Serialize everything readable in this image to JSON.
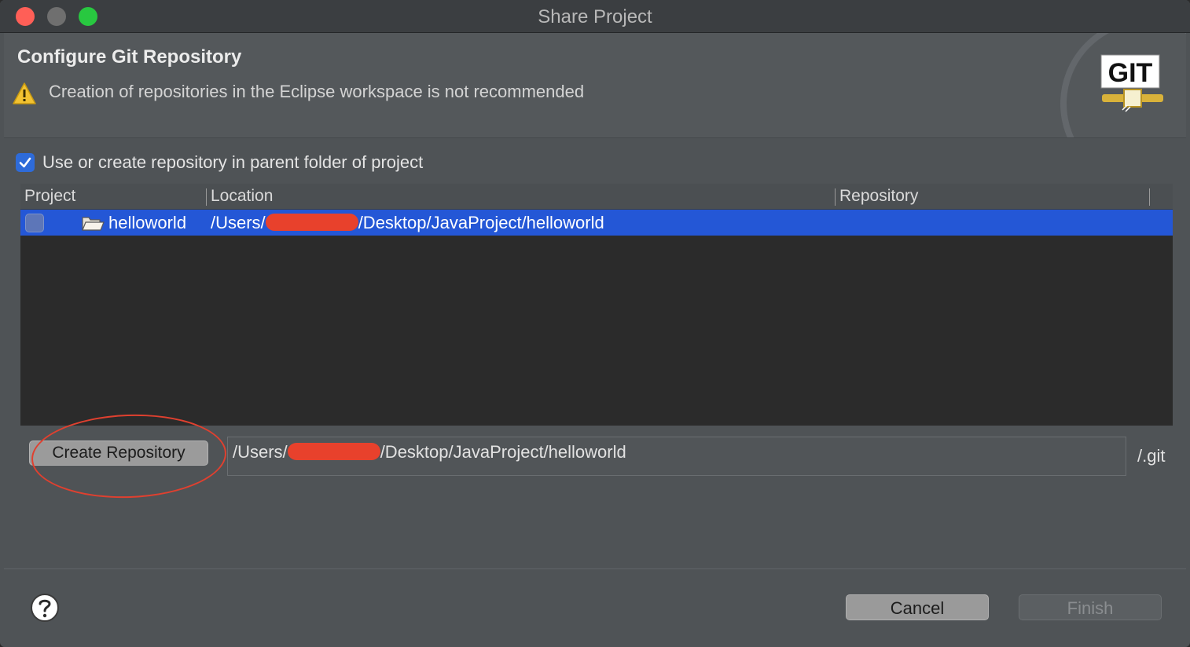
{
  "window": {
    "title": "Share Project"
  },
  "header": {
    "title": "Configure Git Repository",
    "warning": "Creation of repositories in the Eclipse workspace is not recommended",
    "logo_text": "GIT"
  },
  "options": {
    "use_parent_label": "Use or create repository in parent folder of project",
    "use_parent_checked": true
  },
  "table": {
    "columns": [
      "Project",
      "Location",
      "Repository"
    ],
    "rows": [
      {
        "project": "helloworld",
        "location_prefix": "/Users/",
        "location_suffix": "/Desktop/JavaProject/helloworld",
        "repository": "",
        "checked": false,
        "selected": true
      }
    ]
  },
  "repository": {
    "create_button_label": "Create Repository",
    "path_prefix": "/Users/",
    "path_suffix": "/Desktop/JavaProject/helloworld",
    "git_suffix": "/.git"
  },
  "footer": {
    "cancel_label": "Cancel",
    "finish_label": "Finish",
    "finish_enabled": false
  },
  "colors": {
    "selection": "#2457d6",
    "checkbox_accent": "#2e6bd9",
    "redaction": "#e8412c",
    "annotation": "#e0402f"
  }
}
